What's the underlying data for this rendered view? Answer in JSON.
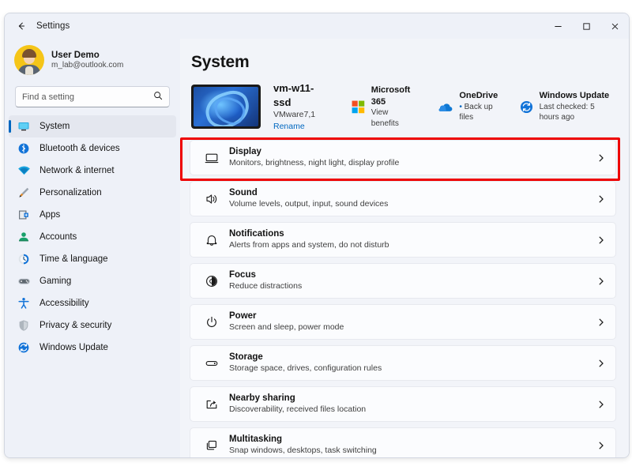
{
  "window": {
    "title": "Settings",
    "back_icon": "arrow-left-icon",
    "controls": {
      "minimize": "─",
      "maximize": "☐",
      "close": "✕"
    }
  },
  "sidebar": {
    "account": {
      "name": "User Demo",
      "email": "m_lab@outlook.com",
      "avatar_color": "#f5c518"
    },
    "search": {
      "placeholder": "Find a setting",
      "value": "",
      "icon": "search-icon"
    },
    "items": [
      {
        "label": "System",
        "icon": "monitor-icon",
        "active": true
      },
      {
        "label": "Bluetooth & devices",
        "icon": "bluetooth-icon",
        "active": false
      },
      {
        "label": "Network & internet",
        "icon": "wifi-icon",
        "active": false
      },
      {
        "label": "Personalization",
        "icon": "brush-icon",
        "active": false
      },
      {
        "label": "Apps",
        "icon": "apps-icon",
        "active": false
      },
      {
        "label": "Accounts",
        "icon": "account-icon",
        "active": false
      },
      {
        "label": "Time & language",
        "icon": "clock-icon",
        "active": false
      },
      {
        "label": "Gaming",
        "icon": "gamepad-icon",
        "active": false
      },
      {
        "label": "Accessibility",
        "icon": "accessibility-icon",
        "active": false
      },
      {
        "label": "Privacy & security",
        "icon": "shield-icon",
        "active": false
      },
      {
        "label": "Windows Update",
        "icon": "update-icon",
        "active": false
      }
    ],
    "accent_color": "#0067c0",
    "background_color": "#eef1f8"
  },
  "main": {
    "title": "System",
    "device": {
      "name": "vm-w11-ssd",
      "model": "VMware7,1",
      "rename_label": "Rename",
      "thumbnail": "windows-bloom-wallpaper"
    },
    "quicklinks": [
      {
        "title": "Microsoft 365",
        "sub": "View benefits",
        "icon": "microsoft-logo-icon",
        "bullet": false
      },
      {
        "title": "OneDrive",
        "sub": "Back up files",
        "icon": "onedrive-cloud-icon",
        "bullet": true
      },
      {
        "title": "Windows Update",
        "sub": "Last checked: 5 hours ago",
        "icon": "windows-update-icon",
        "bullet": false
      }
    ],
    "rows": [
      {
        "title": "Display",
        "sub": "Monitors, brightness, night light, display profile",
        "icon": "monitor-icon",
        "highlighted": true
      },
      {
        "title": "Sound",
        "sub": "Volume levels, output, input, sound devices",
        "icon": "speaker-icon",
        "highlighted": false
      },
      {
        "title": "Notifications",
        "sub": "Alerts from apps and system, do not disturb",
        "icon": "bell-icon",
        "highlighted": false
      },
      {
        "title": "Focus",
        "sub": "Reduce distractions",
        "icon": "focus-icon",
        "highlighted": false
      },
      {
        "title": "Power",
        "sub": "Screen and sleep, power mode",
        "icon": "power-icon",
        "highlighted": false
      },
      {
        "title": "Storage",
        "sub": "Storage space, drives, configuration rules",
        "icon": "storage-icon",
        "highlighted": false
      },
      {
        "title": "Nearby sharing",
        "sub": "Discoverability, received files location",
        "icon": "share-icon",
        "highlighted": false
      },
      {
        "title": "Multitasking",
        "sub": "Snap windows, desktops, task switching",
        "icon": "multitasking-icon",
        "highlighted": false
      }
    ],
    "chevron_icon": "chevron-right-icon",
    "highlight_color": "#ee0000"
  }
}
